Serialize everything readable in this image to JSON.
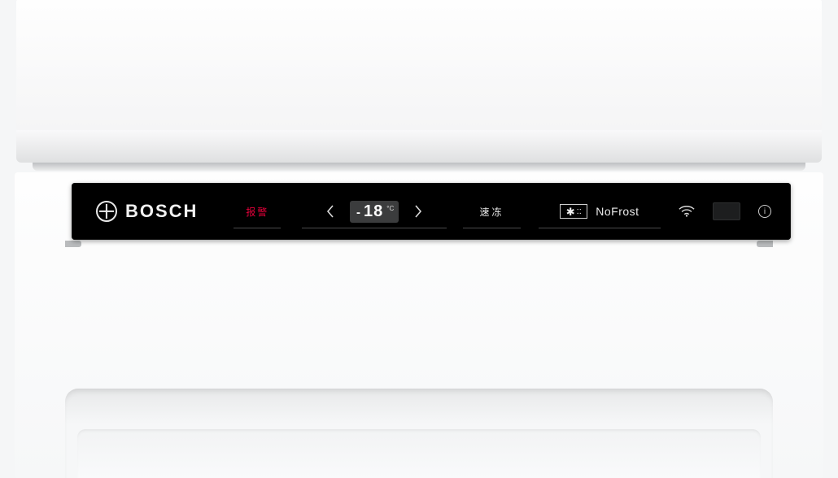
{
  "brand": {
    "name": "BOSCH"
  },
  "panel": {
    "alarm_label": "报警",
    "temperature": {
      "sign": "-",
      "value": "18",
      "unit": "°C"
    },
    "fastfreeze_label": "速冻",
    "nofrost": {
      "badge_symbol": "✱",
      "badge_dots": "::",
      "label": "NoFrost"
    },
    "info_glyph": "i"
  }
}
